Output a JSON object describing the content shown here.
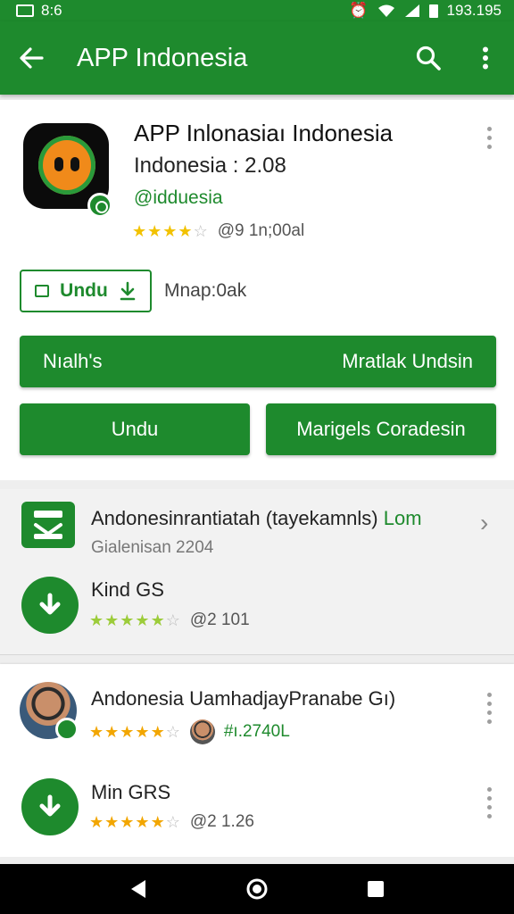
{
  "status_bar": {
    "time": "193.195",
    "left_text": "8:6"
  },
  "header": {
    "title": "APP Indonesia"
  },
  "detail": {
    "app_title": "APP Inlonasiaı Indonesia",
    "subtitle": "Indonesia : 2.08",
    "developer": "@idduesia",
    "rating_text": "@9 1n;00al",
    "outline_button": "Undu",
    "outline_note": "Mnap:0ak",
    "btn_full_left": "Nıalh's",
    "btn_full_right": "Mratlak Undsin",
    "btn_half_left": "Undu",
    "btn_half_right": "Marigels Coradesin"
  },
  "section_related": {
    "header_title": "Andonesinrantiatah (tayekamnls)",
    "header_more": "Lom",
    "header_subtitle": "Gialenisan 2204",
    "item_title": "Kind GS",
    "item_rating": "@2 101"
  },
  "section_list": {
    "item1_title": "Andonesia UamhadjayPranabe Gı)",
    "item1_meta": "#ı.2740L",
    "item2_title": "Min GRS",
    "item2_meta": "@2 1.26"
  },
  "colors": {
    "accent": "#1e8a2d",
    "star_gold": "#f2a600",
    "star_lime": "#9ccc3a"
  },
  "icons": [
    "back-arrow-icon",
    "search-icon",
    "more-vert-icon",
    "download-icon",
    "chevron-right-icon",
    "star-icon",
    "back-nav-icon",
    "home-nav-icon",
    "recents-nav-icon"
  ]
}
